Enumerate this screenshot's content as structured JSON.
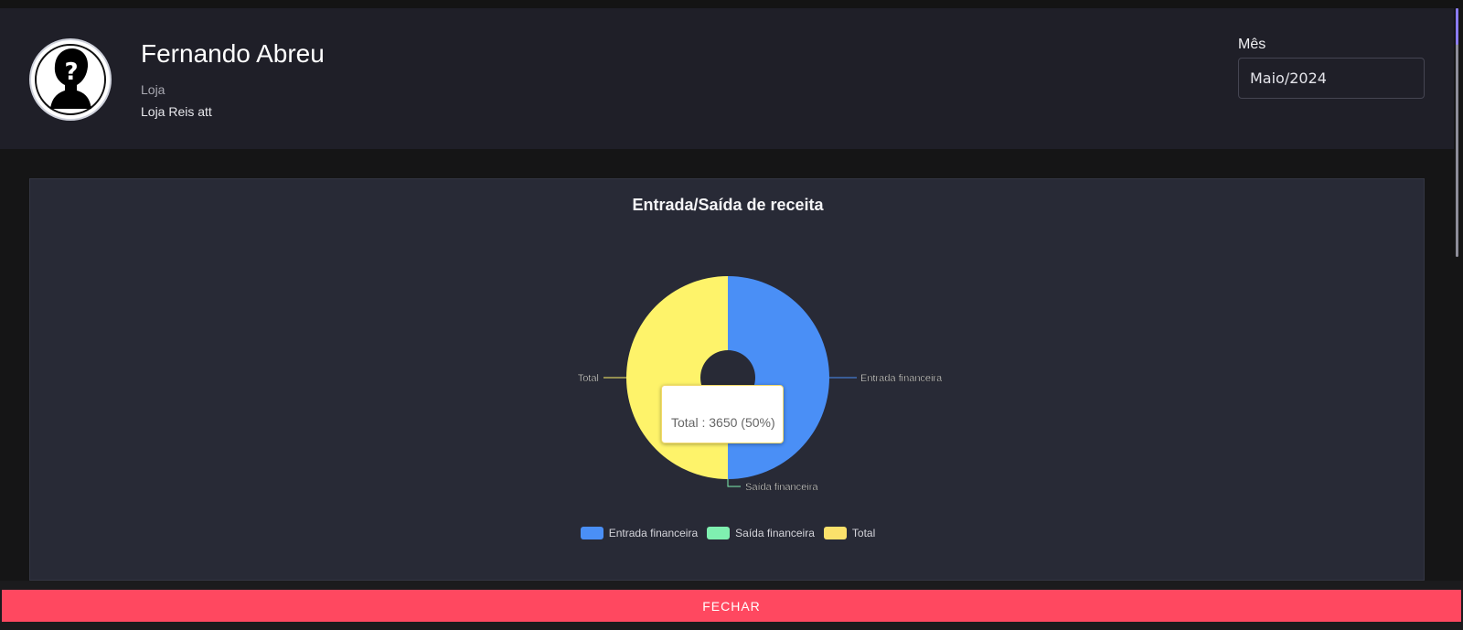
{
  "header": {
    "user_name": "Fernando Abreu",
    "store_label": "Loja",
    "store_value": "Loja Reis att",
    "month_label": "Mês",
    "month_value": "Maio/2024",
    "avatar_icon": "unknown-user-silhouette-icon"
  },
  "chart_data": {
    "type": "pie",
    "title": "Entrada/Saída de receita",
    "categories": [
      "Entrada financeira",
      "Saída financeira",
      "Total"
    ],
    "values": [
      3650,
      0,
      3650
    ],
    "colors": [
      "#4a8ff6",
      "#7ff0b0",
      "#fef36a"
    ],
    "legend_colors": [
      "#4a8ff6",
      "#7ff0b0",
      "#fbe16b"
    ],
    "legend_position": "bottom",
    "tooltip": "Total : 3650 (50%)"
  },
  "footer": {
    "close_label": "FECHAR"
  },
  "colors": {
    "accent": "#ff4860",
    "panel": "#282a36",
    "header": "#1f1f28"
  }
}
